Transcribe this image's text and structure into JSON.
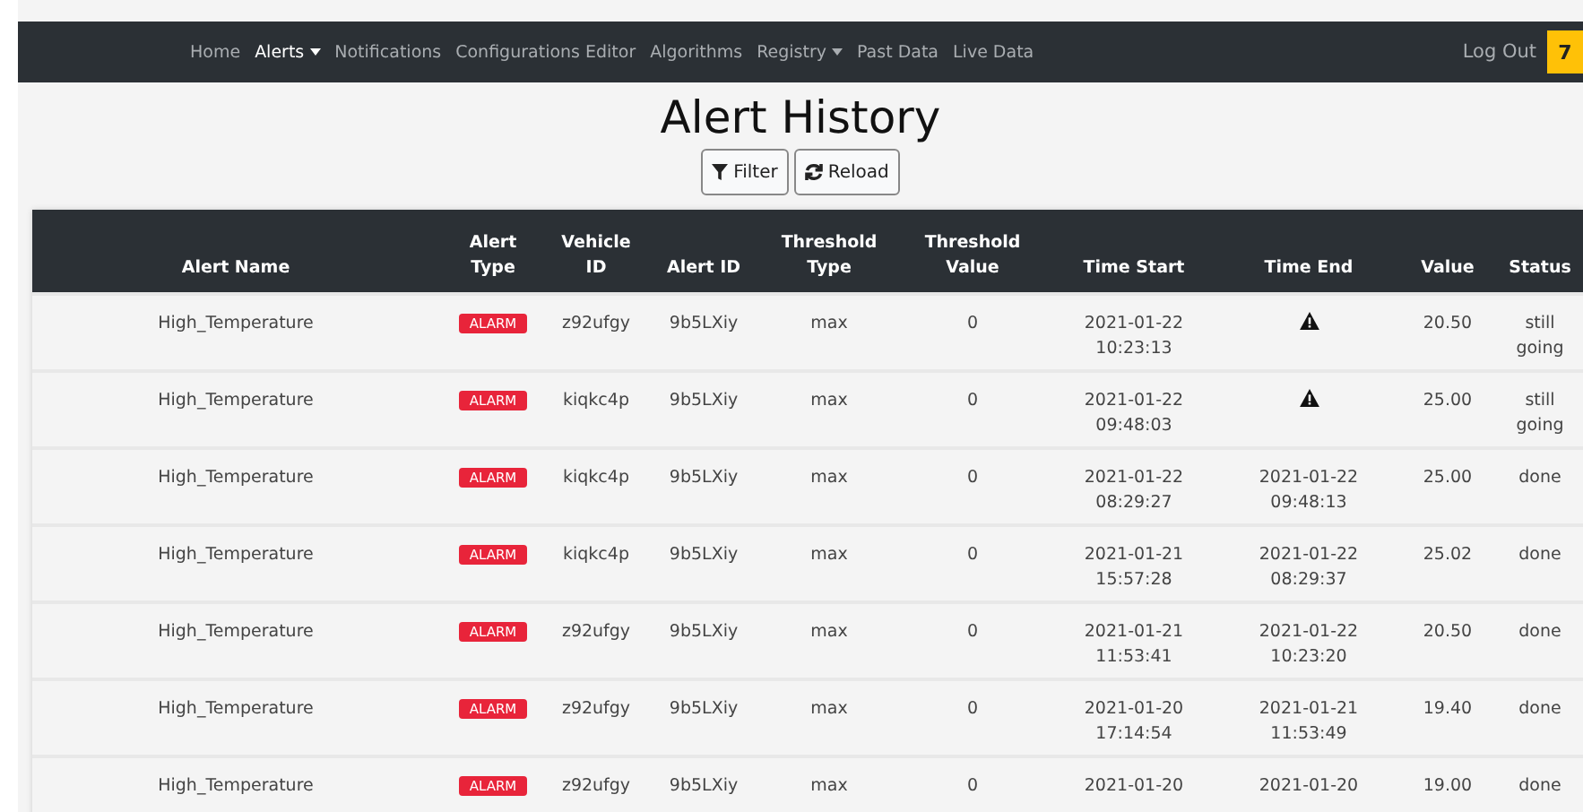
{
  "navbar": {
    "items": [
      {
        "label": "Home",
        "selected": false,
        "dropdown": false
      },
      {
        "label": "Alerts",
        "selected": true,
        "dropdown": true
      },
      {
        "label": "Notifications",
        "selected": false,
        "dropdown": false
      },
      {
        "label": "Configurations Editor",
        "selected": false,
        "dropdown": false
      },
      {
        "label": "Algorithms",
        "selected": false,
        "dropdown": false
      },
      {
        "label": "Registry",
        "selected": false,
        "dropdown": true
      },
      {
        "label": "Past Data",
        "selected": false,
        "dropdown": false
      },
      {
        "label": "Live Data",
        "selected": false,
        "dropdown": false
      }
    ],
    "logout": "Log Out",
    "badge": "7"
  },
  "title": "Alert History",
  "buttons": [
    {
      "kind": "filter",
      "label": "Filter"
    },
    {
      "kind": "reload",
      "label": "Reload"
    }
  ],
  "table": {
    "columns": [
      [
        "Alert Name"
      ],
      [
        "Alert",
        "Type"
      ],
      [
        "Vehicle",
        "ID"
      ],
      [
        "Alert ID"
      ],
      [
        "Threshold",
        "Type"
      ],
      [
        "Threshold",
        "Value"
      ],
      [
        "Time Start"
      ],
      [
        "Time End"
      ],
      [
        "Value"
      ],
      [
        "Status"
      ]
    ],
    "rows": [
      {
        "name": "High_Temperature",
        "type": "ALARM",
        "vehicle": "z92ufgy",
        "alert_id": "9b5LXiy",
        "threshold_type": "max",
        "threshold_value": "0",
        "time_start": [
          "2021-01-22",
          "10:23:13"
        ],
        "value": "20.50",
        "status": "still going"
      },
      {
        "name": "High_Temperature",
        "type": "ALARM",
        "vehicle": "kiqkc4p",
        "alert_id": "9b5LXiy",
        "threshold_type": "max",
        "threshold_value": "0",
        "time_start": [
          "2021-01-22",
          "09:48:03"
        ],
        "value": "25.00",
        "status": "still going"
      },
      {
        "name": "High_Temperature",
        "type": "ALARM",
        "vehicle": "kiqkc4p",
        "alert_id": "9b5LXiy",
        "threshold_type": "max",
        "threshold_value": "0",
        "time_start": [
          "2021-01-22",
          "08:29:27"
        ],
        "time_end": [
          "2021-01-22",
          "09:48:13"
        ],
        "value": "25.00",
        "status": "done"
      },
      {
        "name": "High_Temperature",
        "type": "ALARM",
        "vehicle": "kiqkc4p",
        "alert_id": "9b5LXiy",
        "threshold_type": "max",
        "threshold_value": "0",
        "time_start": [
          "2021-01-21",
          "15:57:28"
        ],
        "time_end": [
          "2021-01-22",
          "08:29:37"
        ],
        "value": "25.02",
        "status": "done"
      },
      {
        "name": "High_Temperature",
        "type": "ALARM",
        "vehicle": "z92ufgy",
        "alert_id": "9b5LXiy",
        "threshold_type": "max",
        "threshold_value": "0",
        "time_start": [
          "2021-01-21",
          "11:53:41"
        ],
        "time_end": [
          "2021-01-22",
          "10:23:20"
        ],
        "value": "20.50",
        "status": "done"
      },
      {
        "name": "High_Temperature",
        "type": "ALARM",
        "vehicle": "z92ufgy",
        "alert_id": "9b5LXiy",
        "threshold_type": "max",
        "threshold_value": "0",
        "time_start": [
          "2021-01-20",
          "17:14:54"
        ],
        "time_end": [
          "2021-01-21",
          "11:53:49"
        ],
        "value": "19.40",
        "status": "done"
      },
      {
        "name": "High_Temperature",
        "type": "ALARM",
        "vehicle": "z92ufgy",
        "alert_id": "9b5LXiy",
        "threshold_type": "max",
        "threshold_value": "0",
        "time_start": [
          "2021-01-20"
        ],
        "time_end": [
          "2021-01-20"
        ],
        "value": "19.00",
        "status": "done"
      }
    ]
  }
}
